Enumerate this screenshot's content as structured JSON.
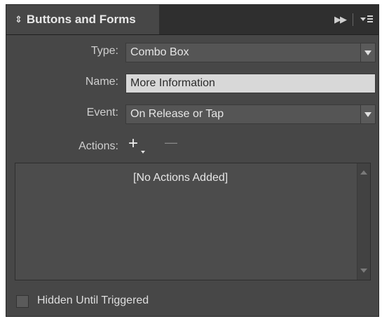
{
  "panel": {
    "title": "Buttons and Forms",
    "title_icon": "sort-updown-icon",
    "header_icons": [
      "fast-forward-icon",
      "panel-menu-icon"
    ]
  },
  "form": {
    "type_label": "Type:",
    "type_value": "Combo Box",
    "name_label": "Name:",
    "name_value": "More Information",
    "event_label": "Event:",
    "event_value": "On Release or Tap",
    "actions_label": "Actions:"
  },
  "actions": {
    "add_symbol": "+",
    "remove_symbol": "—",
    "empty_message": "[No Actions Added]"
  },
  "options": {
    "hidden_until_triggered_label": "Hidden Until Triggered",
    "hidden_until_triggered_checked": false
  },
  "colors": {
    "panel_bg": "#474747",
    "tabbar_bg": "#2f2f2f",
    "field_bg": "#555555",
    "textfield_bg": "#d8d8d8"
  }
}
